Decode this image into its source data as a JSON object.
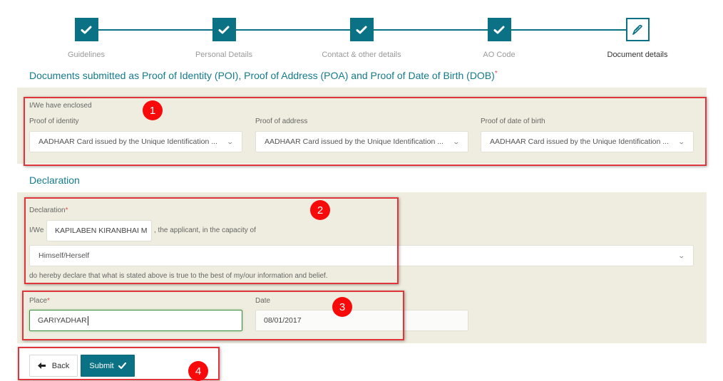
{
  "stepper": {
    "steps": [
      {
        "label": "Guidelines",
        "state": "completed",
        "icon": "check-icon"
      },
      {
        "label": "Personal Details",
        "state": "completed",
        "icon": "check-icon"
      },
      {
        "label": "Contact & other details",
        "state": "completed",
        "icon": "check-icon"
      },
      {
        "label": "AO Code",
        "state": "completed",
        "icon": "check-icon"
      },
      {
        "label": "Document details",
        "state": "current",
        "icon": "pen-icon"
      }
    ]
  },
  "documents": {
    "title": "Documents submitted as Proof of Identity (POI), Proof of Address (POA) and Proof of Date of Birth (DOB)",
    "required_mark": "*",
    "enclosed_label": "I/We have enclosed",
    "proof_identity": {
      "label": "Proof of identity",
      "value": "AADHAAR Card issued by the Unique Identification ..."
    },
    "proof_address": {
      "label": "Proof of address",
      "value": "AADHAAR Card issued by the Unique Identification ..."
    },
    "proof_dob": {
      "label": "Proof of date of birth",
      "value": "AADHAAR Card issued by the Unique Identification ..."
    }
  },
  "declaration": {
    "title": "Declaration",
    "label": "Declaration",
    "required_mark": "*",
    "prefix": "I/We",
    "applicant_name": "KAPILABEN KIRANBHAI M",
    "suffix": ", the applicant, in the capacity of",
    "capacity_value": "Himself/Herself",
    "statement": "do hereby declare that what is stated above is true to the best of my/our information and belief."
  },
  "place_date": {
    "place_label": "Place",
    "required_mark": "*",
    "place_value": "GARIYADHAR",
    "date_label": "Date",
    "date_value": "08/01/2017"
  },
  "actions": {
    "back_label": "Back",
    "submit_label": "Submit"
  },
  "annotations": {
    "badges": [
      "1",
      "2",
      "3",
      "4"
    ]
  },
  "colors": {
    "accent": "#0b7285",
    "panel_bg": "#efeddf",
    "annotation_red": "#e0353b",
    "required": "#e0534f"
  }
}
